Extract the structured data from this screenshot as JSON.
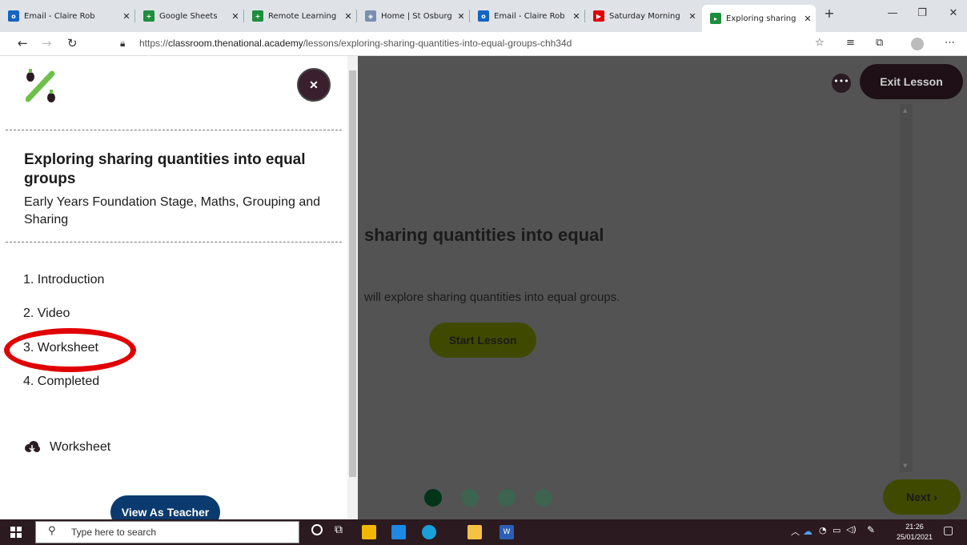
{
  "browser": {
    "tabs": [
      {
        "title": "Email - Claire Rob",
        "icon": "outlook-icon",
        "color": "#1565c0"
      },
      {
        "title": "Google Sheets",
        "icon": "sheets-icon",
        "color": "#1e8e3e"
      },
      {
        "title": "Remote Learning",
        "icon": "sheets-icon",
        "color": "#1e8e3e"
      },
      {
        "title": "Home | St Osburg",
        "icon": "school-crest-icon",
        "color": "#7a8fb0"
      },
      {
        "title": "Email - Claire Rob",
        "icon": "outlook-icon",
        "color": "#1565c0"
      },
      {
        "title": "Saturday Morning",
        "icon": "youtube-icon",
        "color": "#e00000"
      },
      {
        "title": "Exploring sharing",
        "icon": "oak-academy-icon",
        "color": "#1e8e3e",
        "active": true
      }
    ],
    "url_prefix": "https://",
    "url_host": "classroom.thenational.academy",
    "url_path": "/lessons/exploring-sharing-quantities-into-equal-groups-chh34d"
  },
  "sidebar": {
    "lesson_title": "Exploring sharing quantities into equal groups",
    "lesson_subtitle": "Early Years Foundation Stage, Maths, Grouping and Sharing",
    "sections": [
      "1. Introduction",
      "2. Video",
      "3. Worksheet",
      "4. Completed"
    ],
    "worksheet_label": "Worksheet",
    "view_as_teacher": "View As Teacher"
  },
  "main": {
    "exit_label": "Exit Lesson",
    "heading": "sharing quantities into equal",
    "description": "will explore sharing quantities into equal groups.",
    "start_label": "Start Lesson",
    "next_label": "Next",
    "progress_total": 4,
    "progress_current": 1
  },
  "taskbar": {
    "search_placeholder": "Type here to search",
    "time": "21:26",
    "date": "25/01/2021"
  },
  "colors": {
    "accent_green": "#4caf50",
    "dark_button": "#1e1016",
    "annotation_red": "#e00000",
    "teacher_blue": "#0b3a6e"
  }
}
